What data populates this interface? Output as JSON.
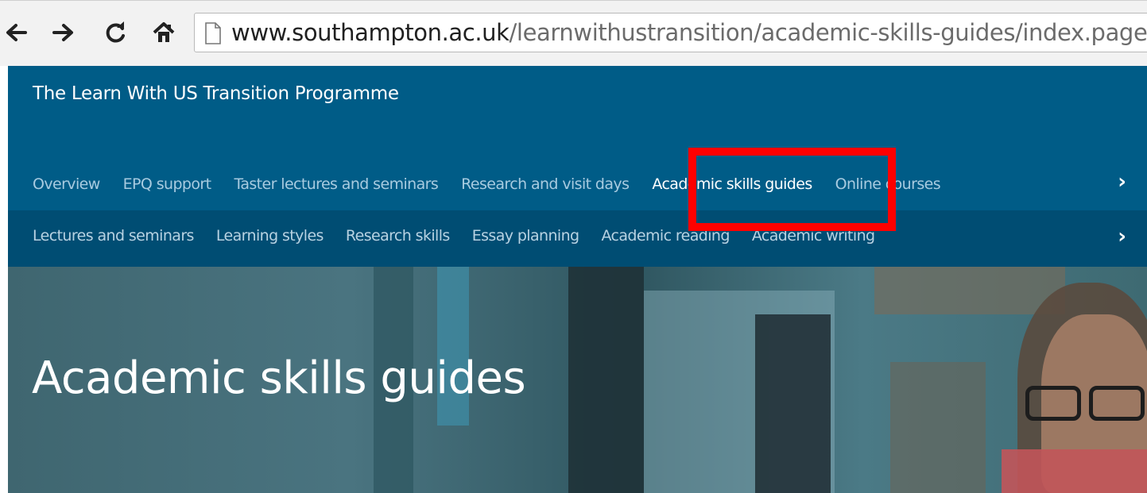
{
  "browser": {
    "url_host": "www.southampton.ac.uk",
    "url_path": "/learnwithustransition/academic-skills-guides/index.page?"
  },
  "site": {
    "title": "The Learn With US Transition Programme"
  },
  "primary_nav": {
    "items": [
      {
        "label": "Overview"
      },
      {
        "label": "EPQ support"
      },
      {
        "label": "Taster lectures and seminars"
      },
      {
        "label": "Research and visit days"
      },
      {
        "label": "Academic skills guides"
      },
      {
        "label": "Online courses"
      }
    ],
    "active": "Academic skills guides",
    "more_icon": "chevron-right-icon"
  },
  "sub_nav": {
    "items": [
      {
        "label": "Lectures and seminars"
      },
      {
        "label": "Learning styles"
      },
      {
        "label": "Research skills"
      },
      {
        "label": "Essay planning"
      },
      {
        "label": "Academic reading"
      },
      {
        "label": "Academic writing"
      }
    ],
    "more_icon": "chevron-right-icon"
  },
  "hero": {
    "title": "Academic skills guides"
  },
  "colors": {
    "header_blue": "#005c87",
    "subnav_blue": "#004d73",
    "highlight_red": "#ff0000"
  }
}
